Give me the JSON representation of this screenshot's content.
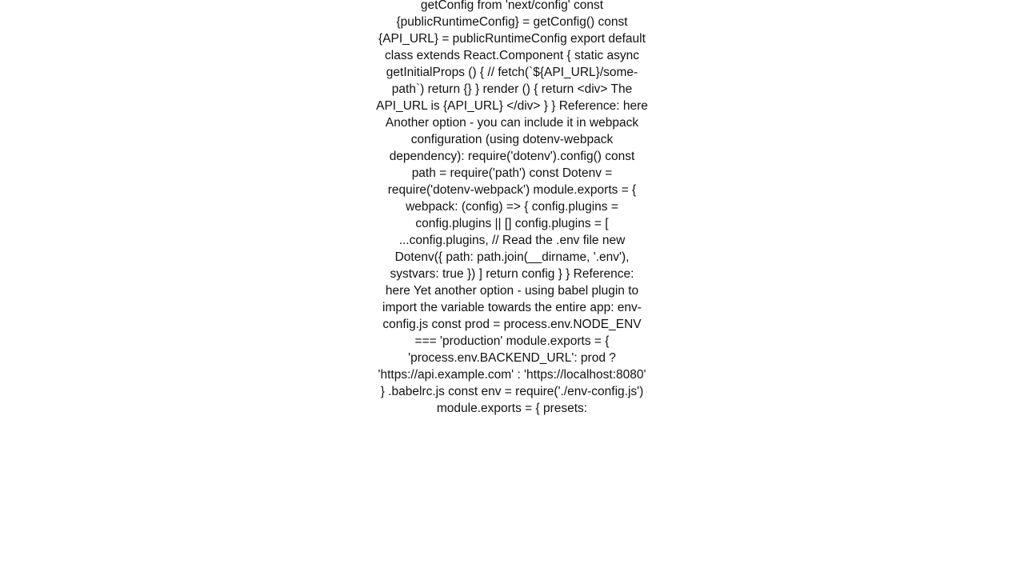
{
  "article": {
    "body": "getConfig from 'next/config'  const {publicRuntimeConfig} = getConfig() const {API_URL} = publicRuntimeConfig  export default class extends React.Component {   static async getInitialProps () {     // fetch(`${API_URL}/some-path`)     return {}   }    render () {     return <div>       The API_URL is {API_URL}     </div>   } }  Reference: here Another option - you can include it in webpack configuration (using dotenv-webpack dependency): require('dotenv').config()  const path = require('path') const Dotenv = require('dotenv-webpack')  module.exports = {   webpack: (config) => {     config.plugins = config.plugins || []      config.plugins = [       ...config.plugins,        // Read the .env file       new Dotenv({         path: path.join(__dirname, '.env'),         systvars: true       })     ]      return config   } }    Reference: here  Yet another option - using babel plugin to import the variable towards the entire app: env-config.js const prod = process.env.NODE_ENV === 'production'  module.exports = {   'process.env.BACKEND_URL': prod ? 'https://api.example.com' : 'https://localhost:8080' }  .babelrc.js const env = require('./env-config.js')  module.exports = {   presets:"
  }
}
